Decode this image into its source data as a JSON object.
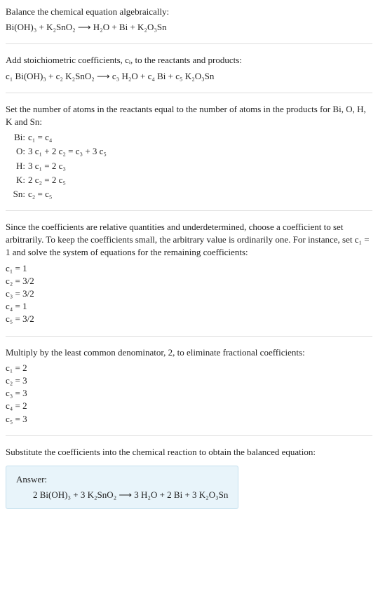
{
  "intro_line1": "Balance the chemical equation algebraically:",
  "intro_eq": "Bi(OH)₃ + K₂SnO₂  ⟶  H₂O + Bi + K₂O₃Sn",
  "stoich_text": "Add stoichiometric coefficients, cᵢ, to the reactants and products:",
  "stoich_eq": "c₁ Bi(OH)₃ + c₂ K₂SnO₂  ⟶  c₃ H₂O + c₄ Bi + c₅ K₂O₃Sn",
  "atoms_text": "Set the number of atoms in the reactants equal to the number of atoms in the products for Bi, O, H, K and Sn:",
  "atom_rows": [
    {
      "el": "Bi:",
      "eq": "c₁ = c₄"
    },
    {
      "el": "O:",
      "eq": "3 c₁ + 2 c₂ = c₃ + 3 c₅"
    },
    {
      "el": "H:",
      "eq": "3 c₁ = 2 c₃"
    },
    {
      "el": "K:",
      "eq": "2 c₂ = 2 c₅"
    },
    {
      "el": "Sn:",
      "eq": "c₂ = c₅"
    }
  ],
  "rel_text": "Since the coefficients are relative quantities and underdetermined, choose a coefficient to set arbitrarily. To keep the coefficients small, the arbitrary value is ordinarily one. For instance, set c₁ = 1 and solve the system of equations for the remaining coefficients:",
  "frac_coeffs": [
    "c₁ = 1",
    "c₂ = 3/2",
    "c₃ = 3/2",
    "c₄ = 1",
    "c₅ = 3/2"
  ],
  "lcd_text": "Multiply by the least common denominator, 2, to eliminate fractional coefficients:",
  "int_coeffs": [
    "c₁ = 2",
    "c₂ = 3",
    "c₃ = 3",
    "c₄ = 2",
    "c₅ = 3"
  ],
  "sub_text": "Substitute the coefficients into the chemical reaction to obtain the balanced equation:",
  "answer_label": "Answer:",
  "answer_eq": "2 Bi(OH)₃ + 3 K₂SnO₂  ⟶  3 H₂O + 2 Bi + 3 K₂O₃Sn"
}
